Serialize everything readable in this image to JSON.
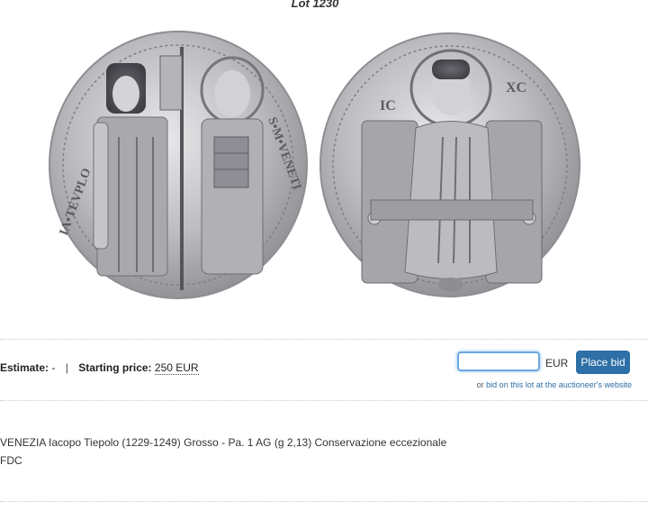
{
  "lot": {
    "title": "Lot 1230"
  },
  "pricing": {
    "estimate_label": "Estimate:",
    "estimate_value": "-",
    "separator": "|",
    "starting_price_label": "Starting price:",
    "starting_price_value": "250 EUR"
  },
  "bid": {
    "input_value": "",
    "currency": "EUR",
    "button_label": "Place bid",
    "note_prefix": "or",
    "note_link": "bid on this lot at the auctioneer's website"
  },
  "description": {
    "line1": "VENEZIA Iacopo Tiepolo (1229-1249) Grosso - Pa. 1 AG (g 2,13) Conservazione eccezionale",
    "line2": "FDC"
  },
  "colors": {
    "accent": "#2d6fa6",
    "coin_silver": "#b9b9bd"
  }
}
